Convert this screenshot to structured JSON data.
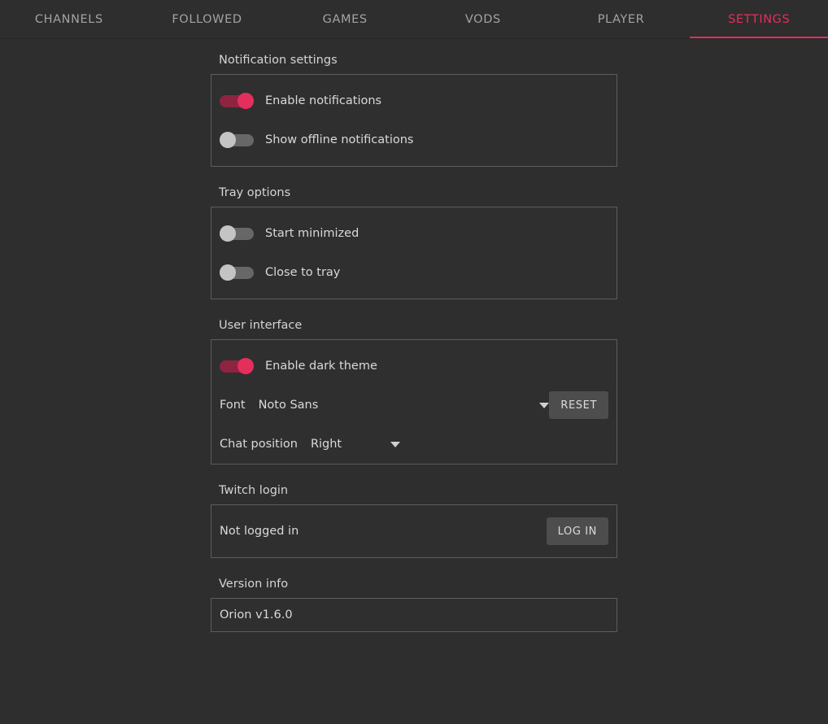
{
  "tabs": [
    {
      "label": "CHANNELS",
      "active": false
    },
    {
      "label": "FOLLOWED",
      "active": false
    },
    {
      "label": "GAMES",
      "active": false
    },
    {
      "label": "VODS",
      "active": false
    },
    {
      "label": "PLAYER",
      "active": false
    },
    {
      "label": "SETTINGS",
      "active": true
    }
  ],
  "accent_color": "#e42f5c",
  "sections": {
    "notifications": {
      "label": "Notification settings",
      "enable_notifications": {
        "label": "Enable notifications",
        "state": "on"
      },
      "show_offline": {
        "label": "Show offline notifications",
        "state": "off"
      }
    },
    "tray": {
      "label": "Tray options",
      "start_minimized": {
        "label": "Start minimized",
        "state": "off"
      },
      "close_to_tray": {
        "label": "Close to tray",
        "state": "off"
      }
    },
    "ui": {
      "label": "User interface",
      "dark_theme": {
        "label": "Enable dark theme",
        "state": "on"
      },
      "font": {
        "label": "Font",
        "value": "Noto Sans"
      },
      "reset_label": "RESET",
      "chat_position": {
        "label": "Chat position",
        "value": "Right"
      }
    },
    "login": {
      "label": "Twitch login",
      "status": "Not logged in",
      "button_label": "LOG IN"
    },
    "version": {
      "label": "Version info",
      "value": "Orion v1.6.0"
    }
  }
}
